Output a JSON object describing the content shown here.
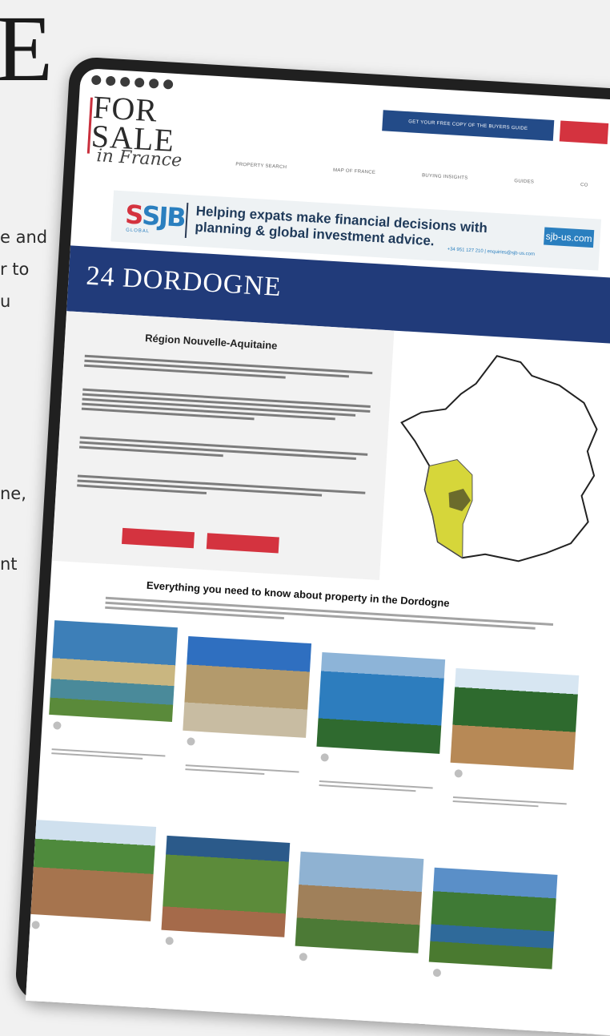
{
  "background": {
    "letter": "E",
    "fragments": [
      "e and",
      "r to",
      "u",
      "ne,",
      "nt"
    ]
  },
  "site": {
    "logo": {
      "line1": "FOR",
      "line2": "SALE",
      "line3": "in France"
    },
    "cta_label": "GET YOUR FREE COPY OF THE BUYERS GUIDE",
    "nav": [
      "PROPERTY SEARCH",
      "MAP OF FRANCE",
      "BUYING INSIGHTS",
      "GUIDES",
      "CO"
    ]
  },
  "ad": {
    "brand": "SJB",
    "brand_sub": "GLOBAL",
    "message_line1": "Helping expats make financial decisions with",
    "message_line2": "planning & global investment advice.",
    "url": "sjb-us.com",
    "contact": "+34 951 127 210 | enquiries@sjb-us.com"
  },
  "hero": {
    "title": "24 DORDOGNE"
  },
  "region": {
    "title": "Région Nouvelle-Aquitaine"
  },
  "section": {
    "title": "Everything you need to know about property in the Dordogne"
  },
  "cards": [
    {
      "image": "lake-chateau"
    },
    {
      "image": "chateau-courtyard"
    },
    {
      "image": "river-bridge"
    },
    {
      "image": "cliff-village"
    },
    {
      "image": "village-tower"
    },
    {
      "image": "vineyard"
    },
    {
      "image": "town-tree"
    },
    {
      "image": "river-valley"
    }
  ],
  "colors": {
    "navy": "#213b7a",
    "red": "#d4333f",
    "blue": "#2a7fbf",
    "map_region": "#d6d63a",
    "map_dept": "#6b6b2c"
  }
}
